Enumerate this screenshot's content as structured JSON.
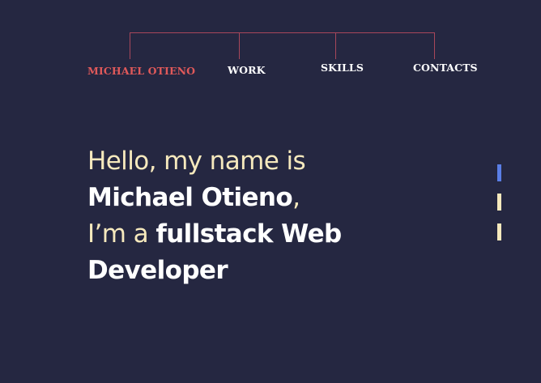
{
  "nav": {
    "brand": "MICHAEL OTIENO",
    "work": "WORK",
    "skills": "SKILLS",
    "contacts": "CONTACTS"
  },
  "hero": {
    "greeting": "Hello, my name is",
    "name": "Michael Otieno",
    "comma": ",",
    "im_a": "I’m a ",
    "role_line1": "fullstack Web",
    "role_line2": "Developer"
  },
  "slide_indicators": [
    {
      "active": true
    },
    {
      "active": false
    },
    {
      "active": false
    }
  ],
  "colors": {
    "background": "#252741",
    "accent_red": "#e0595a",
    "nav_text": "#ffffff",
    "nav_lines": "#a8475a",
    "hero_light": "#f6e9bd",
    "hero_bold": "#ffffff",
    "indicator_active": "#5a7ee6",
    "indicator_inactive": "#f6e9bd"
  }
}
